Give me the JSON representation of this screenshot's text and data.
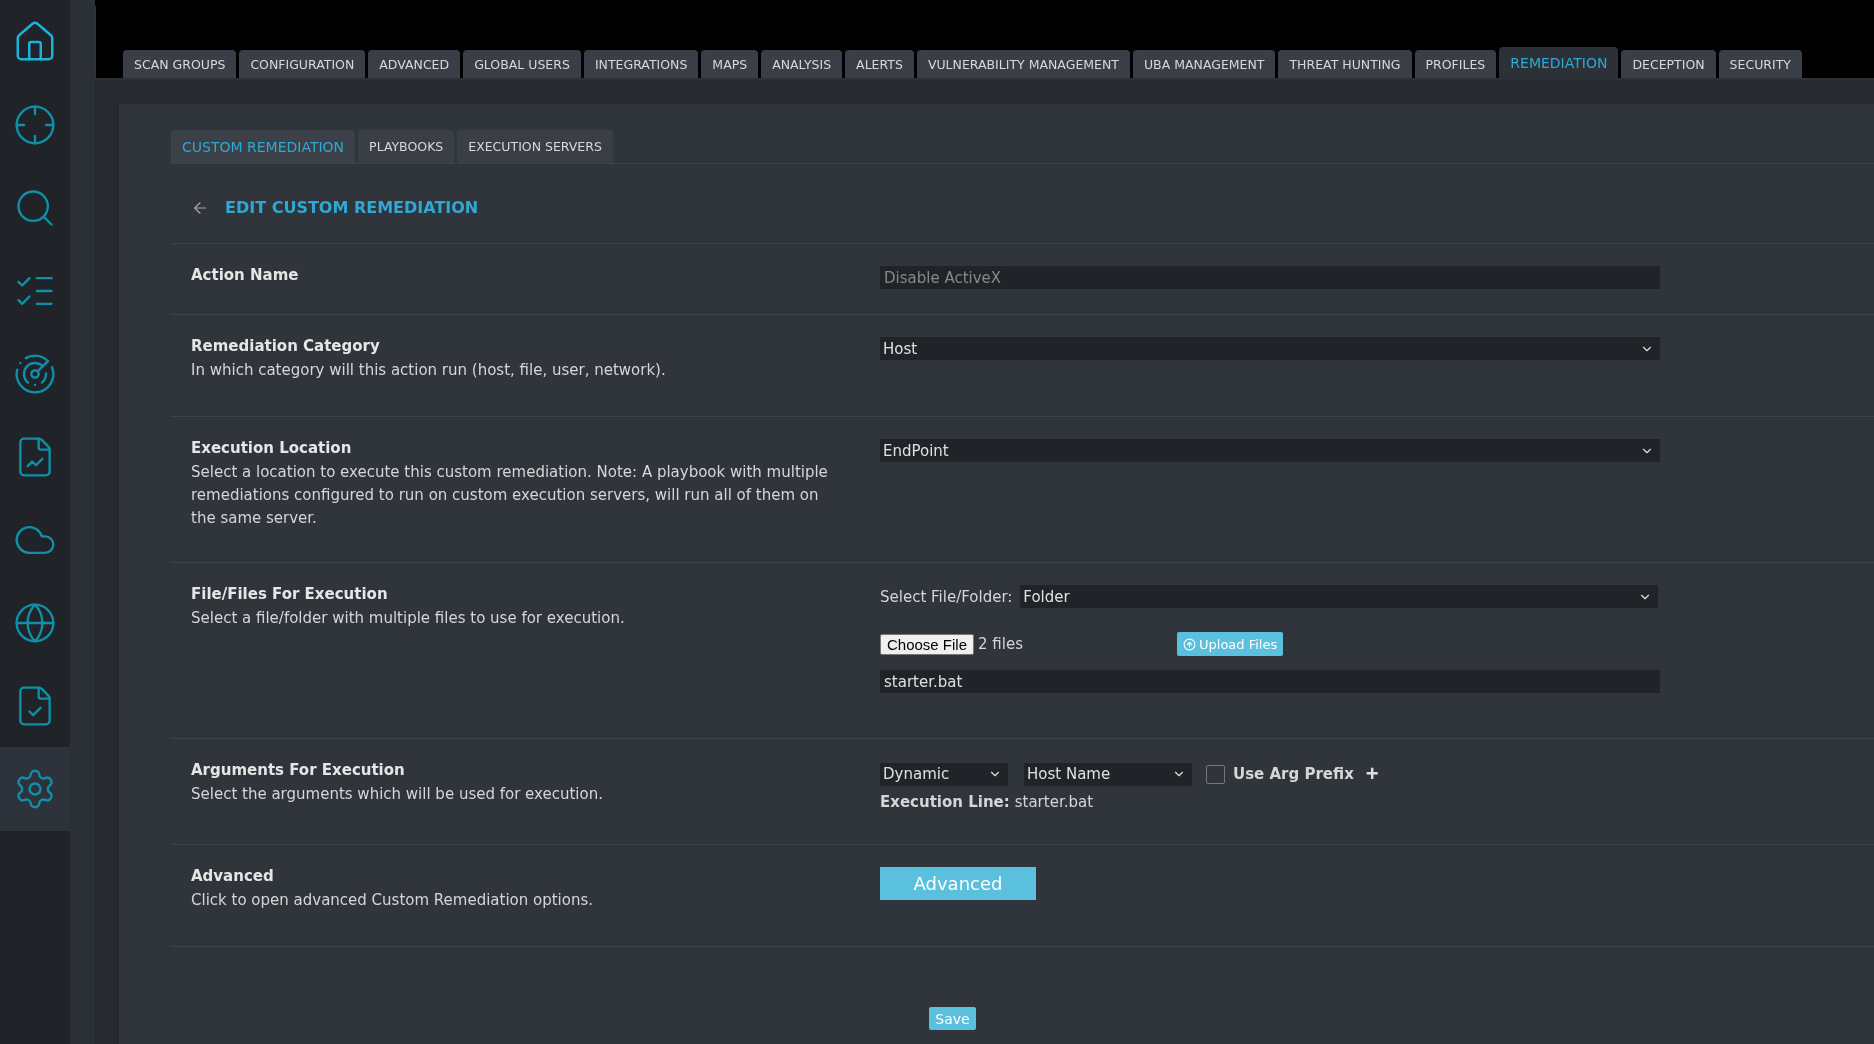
{
  "sidebar": {
    "items": [
      {
        "kind": "home",
        "selected": false
      },
      {
        "kind": "alert",
        "selected": false
      },
      {
        "kind": "search",
        "selected": false
      },
      {
        "kind": "checklist",
        "selected": false
      },
      {
        "kind": "radar",
        "selected": false
      },
      {
        "kind": "report",
        "selected": false
      },
      {
        "kind": "cloud",
        "selected": false
      },
      {
        "kind": "globe",
        "selected": false
      },
      {
        "kind": "audit",
        "selected": false
      },
      {
        "kind": "settings",
        "selected": true
      }
    ]
  },
  "tabs": [
    {
      "label": "SCAN GROUPS",
      "selected": false
    },
    {
      "label": "CONFIGURATION",
      "selected": false
    },
    {
      "label": "ADVANCED",
      "selected": false
    },
    {
      "label": "GLOBAL USERS",
      "selected": false
    },
    {
      "label": "INTEGRATIONS",
      "selected": false
    },
    {
      "label": "MAPS",
      "selected": false
    },
    {
      "label": "ANALYSIS",
      "selected": false
    },
    {
      "label": "ALERTS",
      "selected": false
    },
    {
      "label": "VULNERABILITY MANAGEMENT",
      "selected": false
    },
    {
      "label": "UBA MANAGEMENT",
      "selected": false
    },
    {
      "label": "THREAT HUNTING",
      "selected": false
    },
    {
      "label": "PROFILES",
      "selected": false
    },
    {
      "label": "REMEDIATION",
      "selected": true
    },
    {
      "label": "DECEPTION",
      "selected": false
    },
    {
      "label": "SECURITY",
      "selected": false
    }
  ],
  "subtabs": [
    {
      "label": "CUSTOM REMEDIATION",
      "selected": true
    },
    {
      "label": "PLAYBOOKS",
      "selected": false
    },
    {
      "label": "EXECUTION SERVERS",
      "selected": false
    }
  ],
  "page_title": "EDIT CUSTOM REMEDIATION",
  "form": {
    "action_name": {
      "label": "Action Name",
      "placeholder": "Disable ActiveX"
    },
    "category": {
      "label": "Remediation Category",
      "description": "In which category will this action run (host, file, user, network).",
      "value": "Host"
    },
    "location": {
      "label": "Execution Location",
      "description": "Select a location to execute this custom remediation. Note: A playbook with multiple remediations configured to run on custom execution servers, will run all of them on the same server.",
      "value": "EndPoint"
    },
    "files": {
      "label": "File/Files For Execution",
      "description": "Select a file/folder with multiple files to use for execution.",
      "select_label": "Select File/Folder:",
      "select_value": "Folder",
      "choose_button": "Choose File",
      "chosen": "2 files",
      "upload_button": "Upload Files",
      "file_list": "starter.bat"
    },
    "arguments": {
      "label": "Arguments For Execution",
      "description": "Select the arguments which will be used for execution.",
      "type_value": "Dynamic",
      "arg_value": "Host Name",
      "prefix_label": "Use Arg Prefix",
      "prefix_checked": false,
      "add": "+",
      "exec_label": "Execution Line:",
      "exec_value": "starter.bat"
    },
    "advanced": {
      "label": "Advanced",
      "description": "Click to open advanced Custom Remediation options.",
      "button": "Advanced"
    }
  },
  "save_button": "Save"
}
